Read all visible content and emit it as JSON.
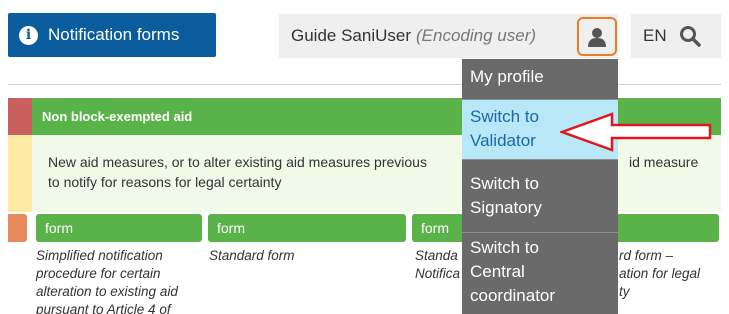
{
  "header": {
    "notification_forms_label": "Notification forms",
    "user_name": "Guide SaniUser",
    "user_role": "(Encoding user)",
    "language": "EN"
  },
  "user_menu": {
    "items": [
      {
        "line1": "My profile",
        "line2": "",
        "line3": ""
      },
      {
        "line1": "Switch to",
        "line2": "Validator",
        "line3": ""
      },
      {
        "line1": "Switch to",
        "line2": "Signatory",
        "line3": ""
      },
      {
        "line1": "Switch to",
        "line2": "Central",
        "line3": "coordinator"
      }
    ]
  },
  "section": {
    "title": "Non block-exempted aid",
    "description_line1": "New aid measures, or to alter existing aid measures previous",
    "description_line1_tail": "id measure",
    "description_line2": "to notify for reasons for legal certainty"
  },
  "forms": [
    {
      "button_label": "form",
      "description": [
        "Simplified notification",
        "procedure for certain",
        "alteration to existing aid",
        "pursuant to Article 4 of"
      ]
    },
    {
      "button_label": "form",
      "description": [
        "Standard form"
      ]
    },
    {
      "button_label": "form",
      "description": [
        "Standa",
        "Notifica"
      ]
    },
    {
      "button_label": "",
      "description": [
        "rd form –",
        "ation for legal",
        "ty"
      ]
    }
  ],
  "colors": {
    "brand_blue": "#0a5c9c",
    "highlight_orange": "#ef7b22",
    "menu_gray": "#6a6a6a",
    "menu_active": "#b8e8f8",
    "green": "#5ab348",
    "annotation_red": "#e0171c"
  },
  "icons": {
    "info": "info-icon",
    "user": "user-icon",
    "search": "search-icon",
    "annotation": "red-arrow-annotation"
  }
}
